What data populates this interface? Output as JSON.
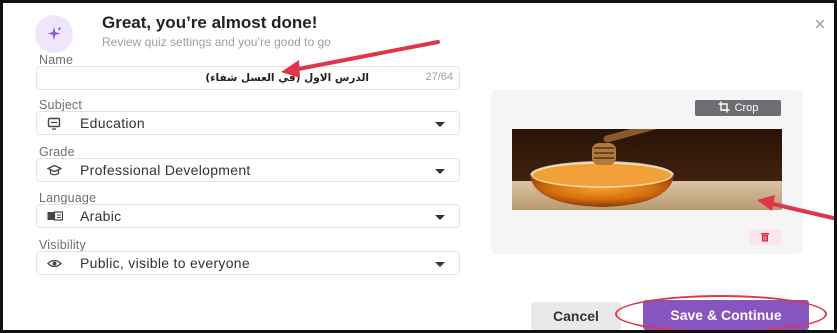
{
  "header": {
    "title": "Great, you’re almost done!",
    "subtitle": "Review quiz settings and you’re good to go"
  },
  "name_field": {
    "label": "Name",
    "value": "الدرس الاول (في العسل شفاء)",
    "counter": "27/64"
  },
  "subject": {
    "label": "Subject",
    "value": "Education",
    "icon": "monitor-icon"
  },
  "grade": {
    "label": "Grade",
    "value": "Professional Development",
    "icon": "graduation-cap-icon"
  },
  "language": {
    "label": "Language",
    "value": "Arabic",
    "icon": "language-icon"
  },
  "visibility": {
    "label": "Visibility",
    "value": "Public, visible to everyone",
    "icon": "eye-icon"
  },
  "image_panel": {
    "crop_label": "Crop",
    "photo_subject": "honey dipper over bowl of honey"
  },
  "footer": {
    "cancel_label": "Cancel",
    "save_label": "Save & Continue"
  },
  "colors": {
    "primary": "#8854c0",
    "annotation_red": "#e0364b",
    "delete_bg": "#fde4ea"
  }
}
